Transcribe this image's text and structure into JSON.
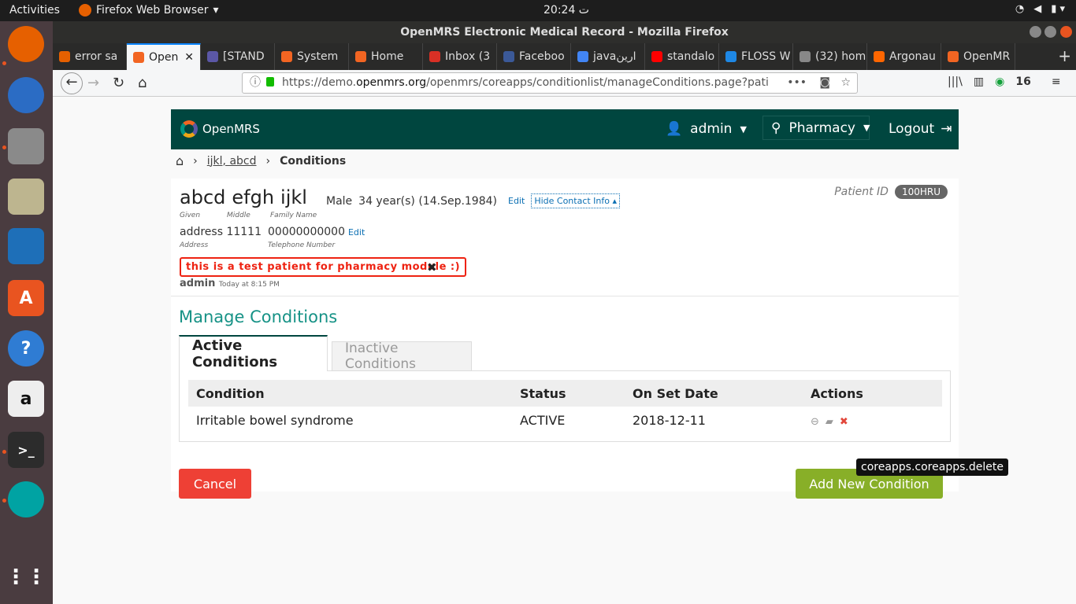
{
  "system": {
    "activities": "Activities",
    "app_name": "Firefox Web Browser",
    "clock": "20:24 ت",
    "battery_count": "16"
  },
  "window": {
    "title": "OpenMRS Electronic Medical Record - Mozilla Firefox"
  },
  "browser": {
    "tabs": [
      {
        "label": "error sa",
        "color": "#e66000"
      },
      {
        "label": "Open",
        "color": "#f26522"
      },
      {
        "label": "[STAND",
        "color": "#5b57a6"
      },
      {
        "label": "System",
        "color": "#f26522"
      },
      {
        "label": "Home",
        "color": "#f26522"
      },
      {
        "label": "Inbox (3",
        "color": "#d93025"
      },
      {
        "label": "Faceboo",
        "color": "#3b5998"
      },
      {
        "label": "javaارين",
        "color": "#4285f4"
      },
      {
        "label": "standalo",
        "color": "#ff0000"
      },
      {
        "label": "FLOSS W",
        "color": "#1e88e5"
      },
      {
        "label": "(32) hom",
        "color": "#888888"
      },
      {
        "label": "Argonau",
        "color": "#ff6600"
      },
      {
        "label": "OpenMR",
        "color": "#f26522"
      }
    ],
    "url_prefix": "https://demo.",
    "url_domain": "openmrs.org",
    "url_rest": "/openmrs/coreapps/conditionlist/manageConditions.page?pati"
  },
  "header": {
    "brand": "OpenMRS",
    "user": "admin",
    "location": "Pharmacy",
    "logout": "Logout"
  },
  "breadcrumb": {
    "patient": "ijkl, abcd",
    "current": "Conditions"
  },
  "patient": {
    "given": "abcd",
    "middle": "efgh",
    "family": "ijkl",
    "given_label": "Given",
    "middle_label": "Middle",
    "family_label": "Family Name",
    "gender": "Male",
    "age": "34 year(s) (14.Sep.1984)",
    "edit": "Edit",
    "hide_contact": "Hide Contact Info",
    "id_label": "Patient ID",
    "id": "100HRU",
    "address": "address 11111",
    "address_label": "Address",
    "phone": "00000000000",
    "phone_label": "Telephone Number",
    "phone_edit": "Edit",
    "note": "this is a test patient for pharmacy module :)",
    "note_author": "admin",
    "note_time": "Today at 8:15 PM"
  },
  "conditions": {
    "title": "Manage Conditions",
    "tab_active": "Active Conditions",
    "tab_inactive": "Inactive Conditions",
    "columns": [
      "Condition",
      "Status",
      "On Set Date",
      "Actions"
    ],
    "rows": [
      {
        "condition": "Irritable bowel syndrome",
        "status": "ACTIVE",
        "onset": "2018-12-11"
      }
    ],
    "cancel": "Cancel",
    "add": "Add New Condition",
    "tooltip": "coreapps.coreapps.delete"
  }
}
